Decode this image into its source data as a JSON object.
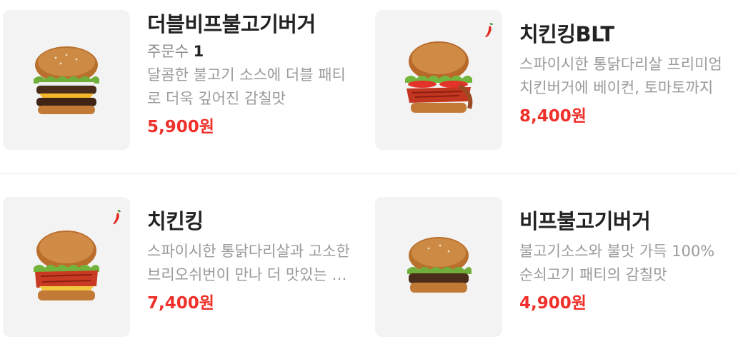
{
  "menu": {
    "items": [
      {
        "name": "더블비프불고기버거",
        "orders_label": "주문수",
        "orders_count": "1",
        "description": "달콤한 불고기 소스에 더블 패티로 더욱 깊어진 감칠맛",
        "price": "5,900원",
        "spicy": false,
        "image_icon": "burger-icon"
      },
      {
        "name": "치킨킹BLT",
        "description": "스파이시한 통닭다리살 프리미엄 치킨버거에 베이컨, 토마토까지",
        "price": "8,400원",
        "spicy": true,
        "image_icon": "burger-icon"
      },
      {
        "name": "치킨킹",
        "description": "스파이시한 통닭다리살과 고소한 브리오쉬번이 만나 더 맛있는 치킨버거",
        "price": "7,400원",
        "spicy": true,
        "image_icon": "burger-icon"
      },
      {
        "name": "비프불고기버거",
        "description": "불고기소스와 불맛 가득 100% 순쇠고기 패티의 감칠맛",
        "price": "4,900원",
        "spicy": false,
        "image_icon": "burger-icon"
      }
    ]
  },
  "colors": {
    "price": "#f0302a",
    "name": "#222222",
    "description": "#9a9a9a",
    "thumb_bg": "#f3f3f3"
  }
}
